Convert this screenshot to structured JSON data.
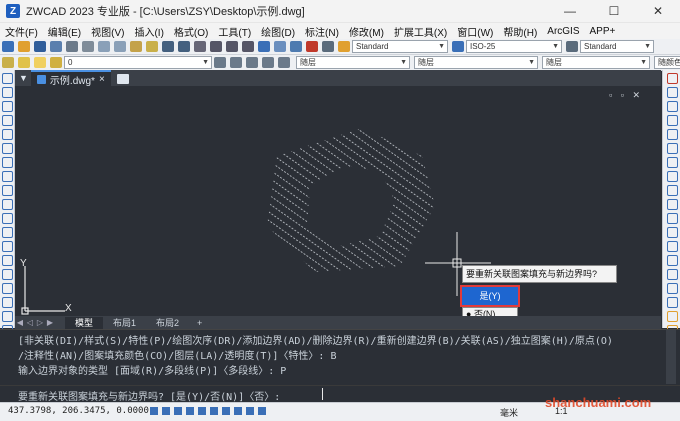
{
  "window": {
    "title": "ZWCAD 2023 专业版 - [C:\\Users\\ZSY\\Desktop\\示例.dwg]",
    "logo": "Z",
    "controls": [
      "—",
      "☐",
      "✕"
    ]
  },
  "menu": [
    "文件(F)",
    "编辑(E)",
    "视图(V)",
    "插入(I)",
    "格式(O)",
    "工具(T)",
    "绘图(D)",
    "标注(N)",
    "修改(M)",
    "扩展工具(X)",
    "窗口(W)",
    "帮助(H)",
    "ArcGIS",
    "APP+"
  ],
  "toolbar1": {
    "text_style": "Standard",
    "dim_style": "ISO-25",
    "table_style": "Standard"
  },
  "toolbar2": {
    "layer": "0",
    "color": "随层",
    "linetype": "随层",
    "lineweight": "随层",
    "plotstyle": "随颜色"
  },
  "doc_tab": {
    "label": "示例.dwg*",
    "close": "×"
  },
  "viewport_controls": "▫ ▫ ✕",
  "axes": {
    "y": "Y",
    "x": "X"
  },
  "prompt": {
    "question": "要重新关联图案填充与新边界吗?",
    "yes": "是(Y)",
    "no": "否(N)"
  },
  "layout_tabs": [
    "模型",
    "布局1",
    "布局2",
    "+"
  ],
  "command_history": [
    "[非关联(DI)/样式(S)/特性(P)/绘图次序(DR)/添加边界(AD)/删除边界(R)/重新创建边界(B)/关联(AS)/独立图案(H)/原点(O)",
    "/注释性(AN)/图案填充颜色(CO)/图层(LA)/透明度(T)]〈特性〉: B",
    "输入边界对象的类型 [面域(R)/多段线(P)]〈多段线〉: P"
  ],
  "command_prompt": "要重新关联图案填充与新边界吗? [是(Y)/否(N)]〈否〉:",
  "status": {
    "coordinates": "437.3798, 206.3475, 0.0000",
    "unit": "毫米",
    "scale": "1:1"
  },
  "watermark": "shanchuami.com",
  "colors": {
    "canvas": "#2b2f36",
    "accent": "#1e66d0",
    "highlight": "#e23a3a"
  }
}
